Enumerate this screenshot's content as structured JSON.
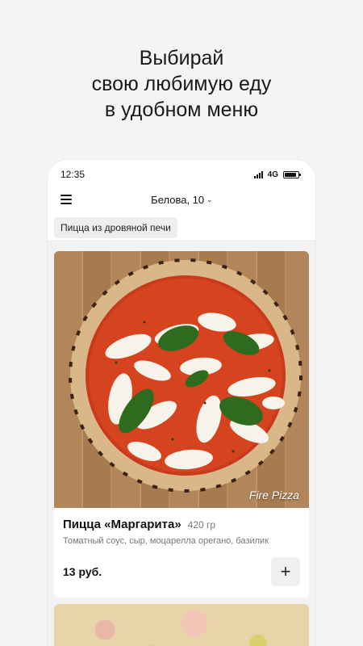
{
  "promo": {
    "line1": "Выбирай",
    "line2": "свою любимую еду",
    "line3": "в удобном меню"
  },
  "status_bar": {
    "time": "12:35",
    "network": "4G",
    "battery_level": 0.85,
    "icons": [
      "signal-icon",
      "battery-icon"
    ]
  },
  "header": {
    "menu_icon": "hamburger-menu-icon",
    "address": "Белова, 10",
    "address_icon": "chevron-down-icon",
    "chevron": "⌄"
  },
  "category": {
    "label": "Пицца из дровяной печи"
  },
  "products": [
    {
      "name": "Пицца «Маргарита»",
      "weight": "420 гр",
      "description": "Томатный соус, сыр, моцарелла орегано, базилик",
      "price": "13 руб.",
      "image_watermark": "Fire Pizza",
      "add_label": "+",
      "add_icon": "plus-icon"
    }
  ]
}
